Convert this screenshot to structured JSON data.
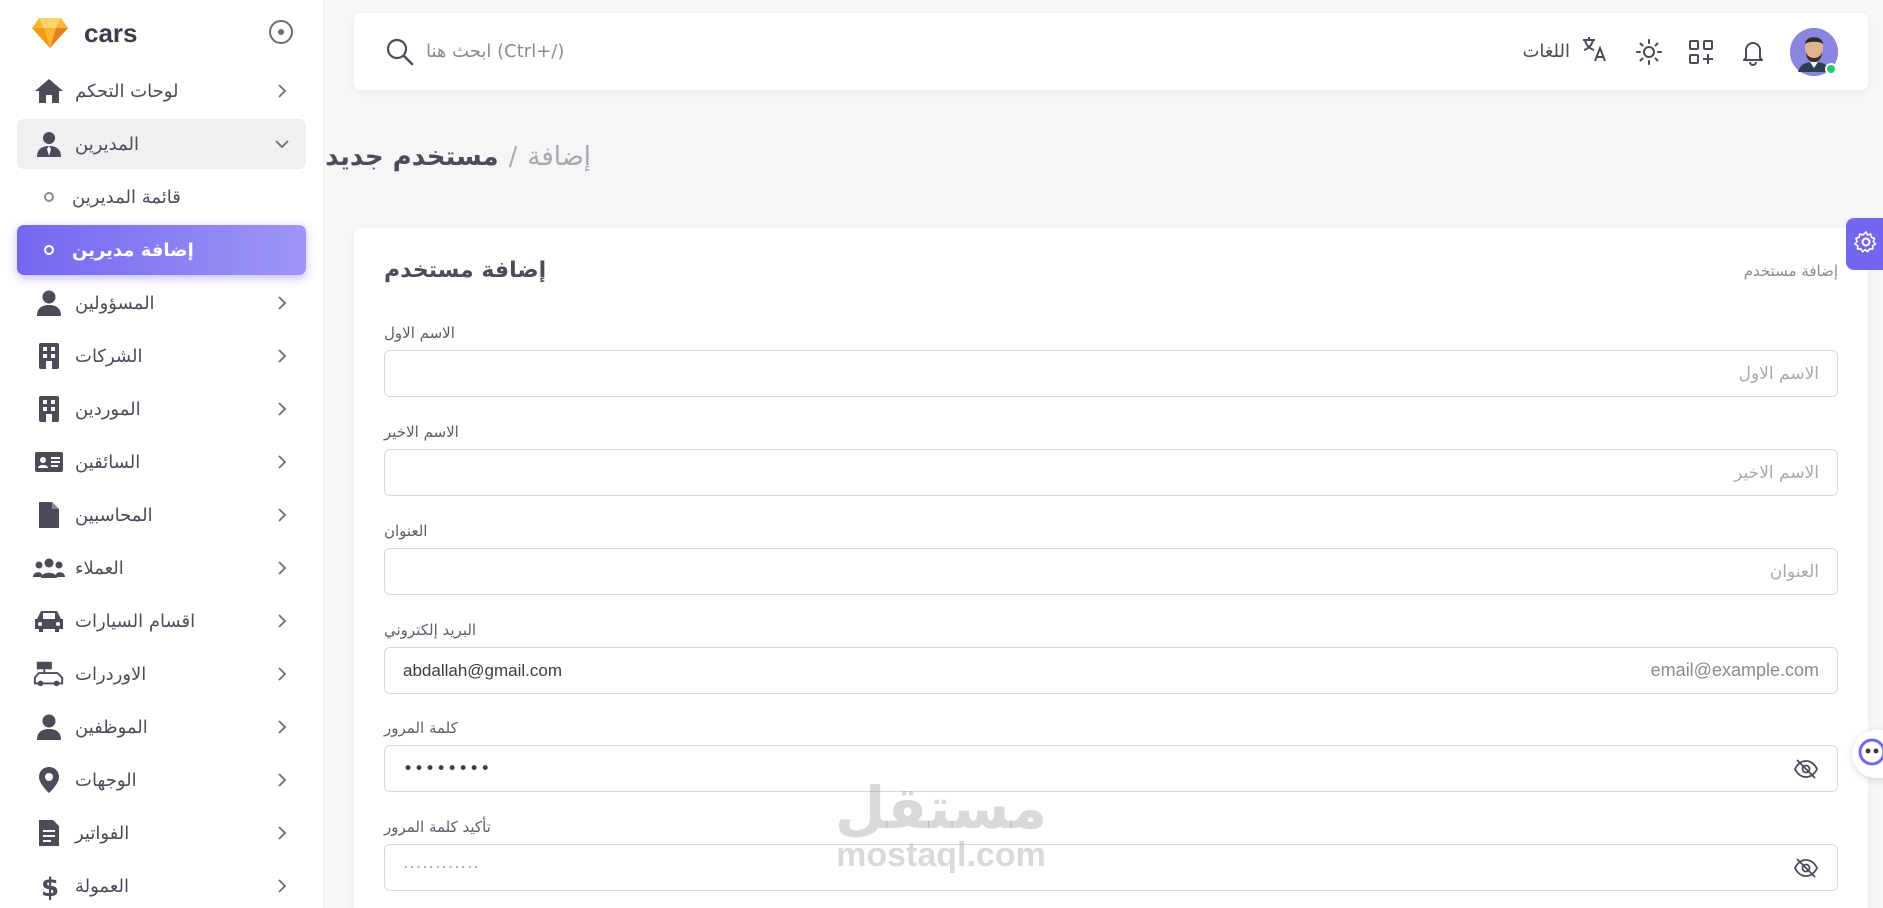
{
  "brand": {
    "name": "cars"
  },
  "sidebar": {
    "items": [
      {
        "label": "لوحات التحكم",
        "icon": "home-icon"
      },
      {
        "label": "المديرين",
        "icon": "user-tie-icon",
        "open": true,
        "children": [
          {
            "label": "قائمة المديرين"
          },
          {
            "label": "إضافة مديرين",
            "active": true
          }
        ]
      },
      {
        "label": "المسؤولين",
        "icon": "user-icon"
      },
      {
        "label": "الشركات",
        "icon": "building-icon"
      },
      {
        "label": "الموردين",
        "icon": "building-icon"
      },
      {
        "label": "السائقين",
        "icon": "id-card-icon"
      },
      {
        "label": "المحاسبين",
        "icon": "file-icon"
      },
      {
        "label": "العملاء",
        "icon": "users-icon"
      },
      {
        "label": "اقسام السيارات",
        "icon": "car-icon"
      },
      {
        "label": "الاوردرات",
        "icon": "rent-car-icon"
      },
      {
        "label": "الموظفين",
        "icon": "user-icon"
      },
      {
        "label": "الوجهات",
        "icon": "location-icon"
      },
      {
        "label": "الفواتير",
        "icon": "invoice-icon"
      },
      {
        "label": "العمولة",
        "icon": "dollar-icon"
      }
    ]
  },
  "topbar": {
    "search_placeholder": "ابحث هنا (Ctrl+/)",
    "language_label": "اللغات"
  },
  "breadcrumb": {
    "parent": "إضافة",
    "separator": "/",
    "current": "مستخدم جديد"
  },
  "card": {
    "title": "إضافة مستخدم",
    "subtitle": "إضافة مستخدم",
    "fields": {
      "first_name": {
        "label": "الاسم الاول",
        "placeholder": "الاسم الاول"
      },
      "last_name": {
        "label": "الاسم الاخير",
        "placeholder": "الاسم الاخير"
      },
      "address": {
        "label": "العنوان",
        "placeholder": "العنوان"
      },
      "email": {
        "label": "البريد إلكتروني",
        "value": "abdallah@gmail.com",
        "hint": "email@example.com"
      },
      "password": {
        "label": "كلمة المرور",
        "value": "••••••••"
      },
      "confirm_password": {
        "label": "تأكيد كلمة المرور",
        "placeholder": "············"
      }
    }
  },
  "watermark": {
    "arabic": "مستقل",
    "latin": "mostaql.com"
  },
  "colors": {
    "primary": "#7367f0",
    "online": "#28c76f"
  }
}
